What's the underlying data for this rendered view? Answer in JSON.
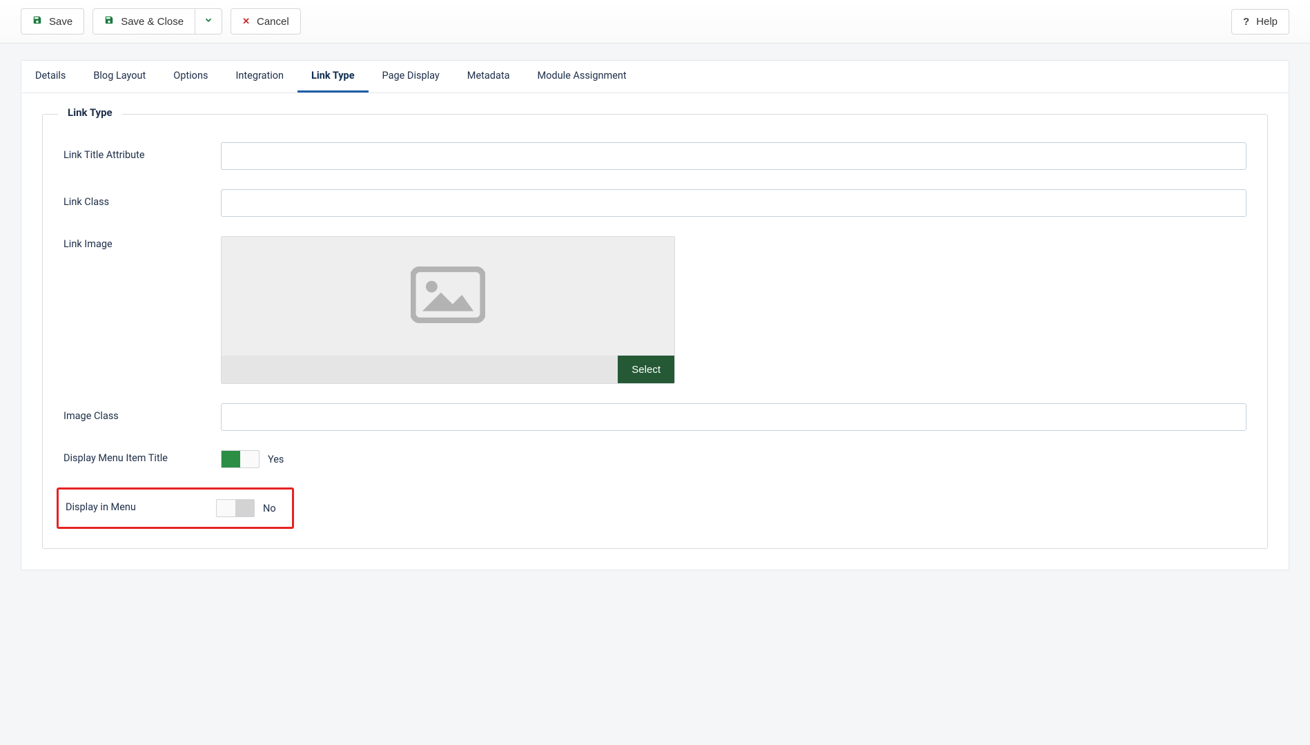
{
  "toolbar": {
    "save_label": "Save",
    "save_close_label": "Save & Close",
    "cancel_label": "Cancel",
    "help_label": "Help"
  },
  "tabs": [
    {
      "label": "Details",
      "active": false
    },
    {
      "label": "Blog Layout",
      "active": false
    },
    {
      "label": "Options",
      "active": false
    },
    {
      "label": "Integration",
      "active": false
    },
    {
      "label": "Link Type",
      "active": true
    },
    {
      "label": "Page Display",
      "active": false
    },
    {
      "label": "Metadata",
      "active": false
    },
    {
      "label": "Module Assignment",
      "active": false
    }
  ],
  "fieldset": {
    "legend": "Link Type",
    "link_title_attribute": {
      "label": "Link Title Attribute",
      "value": ""
    },
    "link_class": {
      "label": "Link Class",
      "value": ""
    },
    "link_image": {
      "label": "Link Image",
      "select_label": "Select"
    },
    "image_class": {
      "label": "Image Class",
      "value": ""
    },
    "display_menu_item_title": {
      "label": "Display Menu Item Title",
      "value": true,
      "state_label": "Yes"
    },
    "display_in_menu": {
      "label": "Display in Menu",
      "value": false,
      "state_label": "No"
    }
  }
}
